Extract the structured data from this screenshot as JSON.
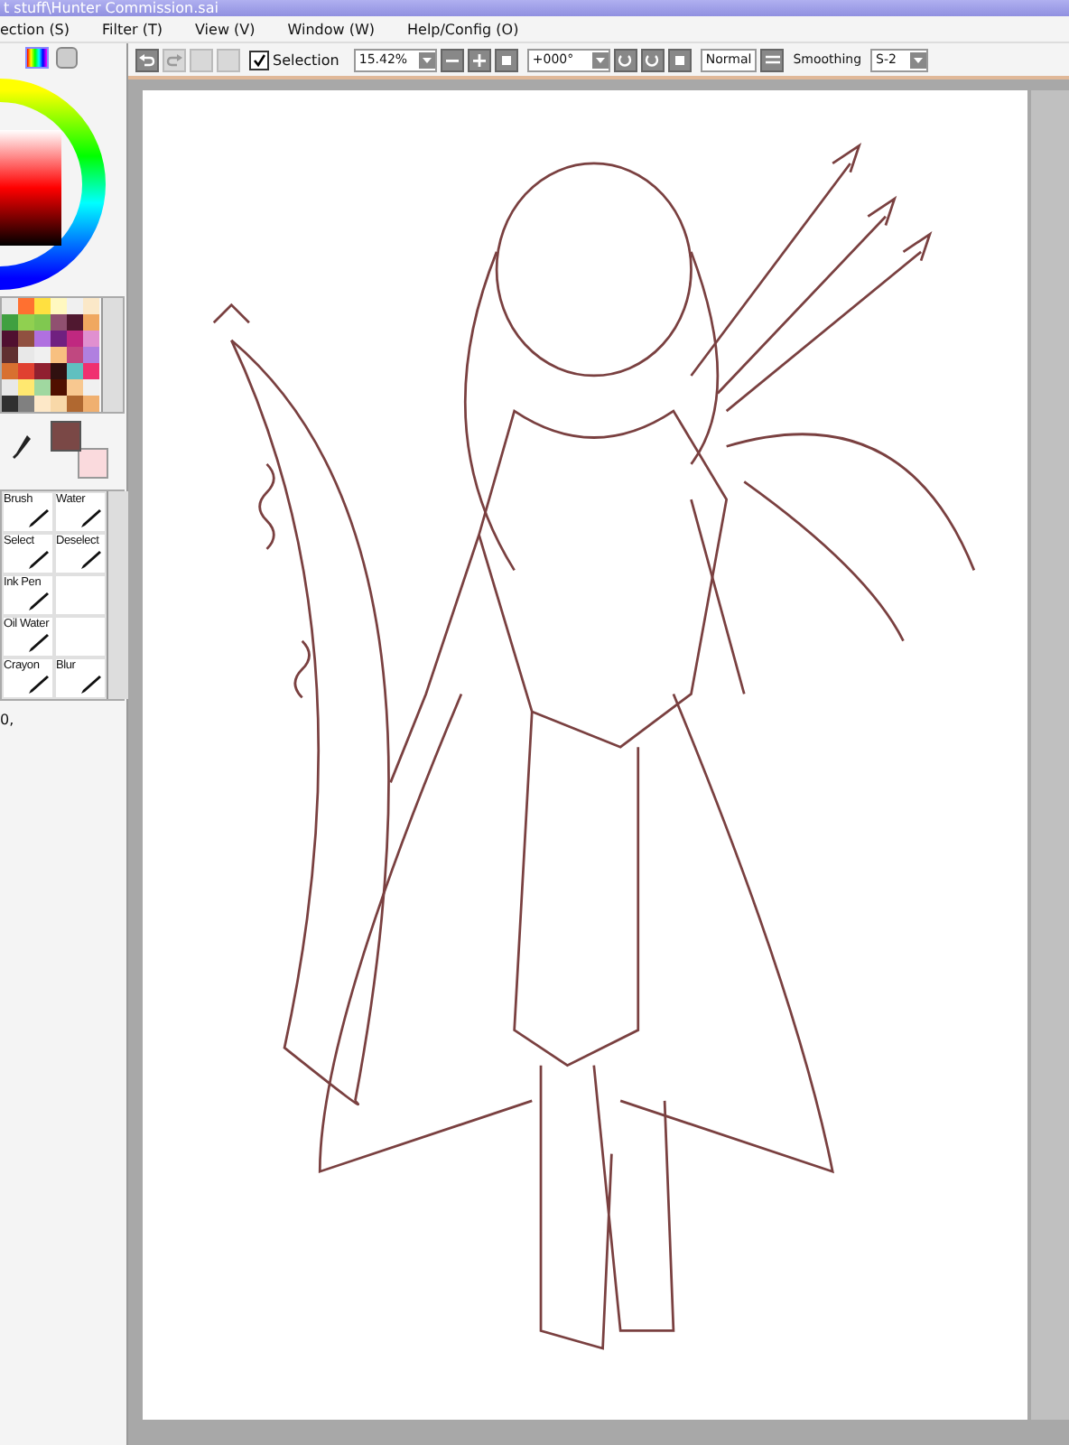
{
  "window": {
    "title": "t stuff\\Hunter Commission.sai"
  },
  "menu": [
    "ection (S)",
    "Filter (T)",
    "View (V)",
    "Window (W)",
    "Help/Config (O)"
  ],
  "toolbar": {
    "selection": {
      "label": "Selection",
      "checked": true
    },
    "zoom": "15.42%",
    "rotation": "+000°",
    "blend_mode": "Normal",
    "smoothing": {
      "label": "Smoothing",
      "value": "S-2"
    }
  },
  "swatches": [
    {
      "color": "#e8e8e8"
    },
    {
      "color": "#ff7030"
    },
    {
      "color": "#ffe040"
    },
    {
      "color": "#fff8c0"
    },
    {
      "color": "#f0f0f0"
    },
    {
      "color": "#fbe8c8"
    },
    {
      "color": "#40a040"
    },
    {
      "color": "#90d050"
    },
    {
      "color": "#80c850"
    },
    {
      "color": "#905070"
    },
    {
      "color": "#501830"
    },
    {
      "color": "#f0a860"
    },
    {
      "color": "#501030"
    },
    {
      "color": "#905040"
    },
    {
      "color": "#b070e0"
    },
    {
      "color": "#702080"
    },
    {
      "color": "#c02880"
    },
    {
      "color": "#e090d0"
    },
    {
      "color": "#603030"
    },
    {
      "color": "#e8e8e8"
    },
    {
      "color": "#f0f0f0"
    },
    {
      "color": "#f8c080"
    },
    {
      "color": "#c04880"
    },
    {
      "color": "#b080e0"
    },
    {
      "color": "#d87030"
    },
    {
      "color": "#e04030"
    },
    {
      "color": "#902030"
    },
    {
      "color": "#301010"
    },
    {
      "color": "#60c0c0"
    },
    {
      "color": "#f03070"
    },
    {
      "color": "#e8e8e8"
    },
    {
      "color": "#ffe870"
    },
    {
      "color": "#a0d8a0"
    },
    {
      "color": "#501000"
    },
    {
      "color": "#f8c890"
    },
    {
      "color": "#f0f0f0"
    },
    {
      "color": "#303030"
    },
    {
      "color": "#808080"
    },
    {
      "color": "#fde8c8"
    },
    {
      "color": "#f8d8a8"
    },
    {
      "color": "#b06830"
    },
    {
      "color": "#f0b070"
    }
  ],
  "color_slots": [
    {
      "color": "#7a4846"
    },
    {
      "color": "#fadadd"
    }
  ],
  "tools": [
    {
      "label": "Brush",
      "selected": false
    },
    {
      "label": "Water",
      "selected": false
    },
    {
      "label": "Select",
      "selected": false
    },
    {
      "label": "Deselect",
      "selected": false
    },
    {
      "label": "Ink Pen",
      "selected": false
    },
    {
      "selected": false
    },
    {
      "label": "Oil Water",
      "selected": false
    },
    {
      "selected": false
    },
    {
      "label": "Crayon",
      "selected": false
    },
    {
      "label": "Blur",
      "selected": false
    }
  ],
  "status": "0,"
}
